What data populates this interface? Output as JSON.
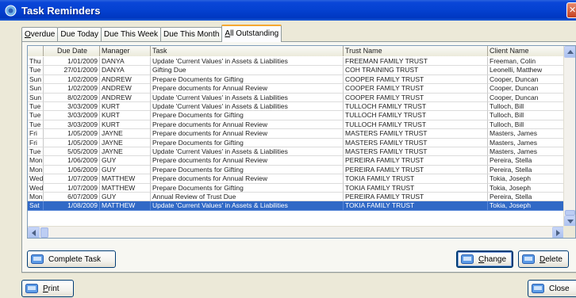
{
  "window": {
    "title": "Task Reminders"
  },
  "tabs": [
    {
      "label": "Overdue",
      "acc": "O",
      "rest": "verdue"
    },
    {
      "label": "Due Today",
      "acc": "",
      "rest": "Due Today"
    },
    {
      "label": "Due This Week",
      "acc": "",
      "rest": "Due This Week"
    },
    {
      "label": "Due This Month",
      "acc": "",
      "rest": "Due This Month"
    },
    {
      "label": "All Outstanding",
      "acc": "A",
      "rest": "ll Outstanding"
    }
  ],
  "grid": {
    "columns": [
      "",
      "Due Date",
      "Manager",
      "Task",
      "Trust Name",
      "Client Name"
    ],
    "rows": [
      [
        "Thu",
        "1/01/2009",
        "DANYA",
        "Update 'Current Values' in Assets & Liabilities",
        "FREEMAN FAMILY TRUST",
        "Freeman, Colin"
      ],
      [
        "Tue",
        "27/01/2009",
        "DANYA",
        "Gifting Due",
        "COH TRAINING TRUST",
        "Leonelli, Matthew"
      ],
      [
        "Sun",
        "1/02/2009",
        "ANDREW",
        "Prepare Documents for Gifting",
        "COOPER FAMILY TRUST",
        "Cooper, Duncan"
      ],
      [
        "Sun",
        "1/02/2009",
        "ANDREW",
        "Prepare documents for Annual Review",
        "COOPER FAMILY TRUST",
        "Cooper, Duncan"
      ],
      [
        "Sun",
        "8/02/2009",
        "ANDREW",
        "Update 'Current Values' in Assets & Liabilities",
        "COOPER FAMILY TRUST",
        "Cooper, Duncan"
      ],
      [
        "Tue",
        "3/03/2009",
        "KURT",
        "Update 'Current Values' in Assets & Liabilities",
        "TULLOCH FAMILY TRUST",
        "Tulloch, Bill"
      ],
      [
        "Tue",
        "3/03/2009",
        "KURT",
        "Prepare Documents for Gifting",
        "TULLOCH FAMILY TRUST",
        "Tulloch, Bill"
      ],
      [
        "Tue",
        "3/03/2009",
        "KURT",
        "Prepare documents for Annual Review",
        "TULLOCH FAMILY TRUST",
        "Tulloch, Bill"
      ],
      [
        "Fri",
        "1/05/2009",
        "JAYNE",
        "Prepare documents for Annual Review",
        "MASTERS FAMILY TRUST",
        "Masters, James"
      ],
      [
        "Fri",
        "1/05/2009",
        "JAYNE",
        "Prepare Documents for Gifting",
        "MASTERS FAMILY TRUST",
        "Masters, James"
      ],
      [
        "Tue",
        "5/05/2009",
        "JAYNE",
        "Update 'Current Values' in Assets & Liabilities",
        "MASTERS FAMILY TRUST",
        "Masters, James"
      ],
      [
        "Mon",
        "1/06/2009",
        "GUY",
        "Prepare documents for Annual Review",
        "PEREIRA FAMILY TRUST",
        "Pereira, Stella"
      ],
      [
        "Mon",
        "1/06/2009",
        "GUY",
        "Prepare Documents for Gifting",
        "PEREIRA FAMILY TRUST",
        "Pereira, Stella"
      ],
      [
        "Wed",
        "1/07/2009",
        "MATTHEW",
        "Prepare documents for Annual Review",
        "TOKIA FAMILY TRUST",
        "Tokia, Joseph"
      ],
      [
        "Wed",
        "1/07/2009",
        "MATTHEW",
        "Prepare Documents for Gifting",
        "TOKIA FAMILY TRUST",
        "Tokia, Joseph"
      ],
      [
        "Mon",
        "6/07/2009",
        "GUY",
        "Annual Review of Trust Due",
        "PEREIRA FAMILY TRUST",
        "Pereira, Stella"
      ],
      [
        "Sat",
        "1/08/2009",
        "MATTHEW",
        "Update 'Current Values' in Assets & Liabilities",
        "TOKIA FAMILY TRUST",
        "Tokia, Joseph"
      ]
    ],
    "selected_row": 16
  },
  "buttons": {
    "complete": {
      "label": "Complete Task"
    },
    "change": {
      "acc": "C",
      "rest": "hange"
    },
    "delete": {
      "acc": "D",
      "rest": "elete"
    },
    "print": {
      "acc": "P",
      "rest": "rint"
    },
    "close": {
      "label": "Close"
    }
  },
  "icons": {
    "app": "app-reminder-icon",
    "button": "task-button-icon"
  },
  "colors": {
    "titlebar": "#0441d0",
    "selection": "#3169c6",
    "active_tab_accent": "#f5a830"
  }
}
